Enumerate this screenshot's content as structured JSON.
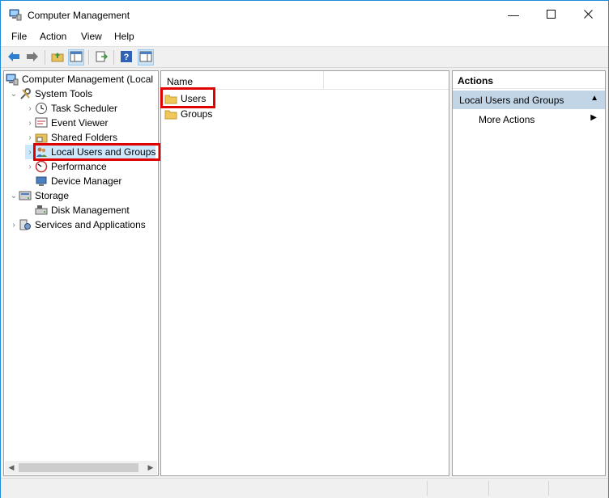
{
  "window": {
    "title": "Computer Management",
    "controls": [
      "minimize",
      "maximize",
      "close"
    ]
  },
  "menu": [
    "File",
    "Action",
    "View",
    "Help"
  ],
  "toolbar": {
    "buttons": [
      "back-icon",
      "forward-icon",
      "up-folder-icon",
      "show-hide-console-tree-icon",
      "export-list-icon",
      "help-icon",
      "show-hide-action-pane-icon"
    ]
  },
  "tree": {
    "root": "Computer Management (Local",
    "items": [
      {
        "label": "System Tools",
        "level": 1,
        "expanded": true
      },
      {
        "label": "Task Scheduler",
        "level": 2
      },
      {
        "label": "Event Viewer",
        "level": 2
      },
      {
        "label": "Shared Folders",
        "level": 2
      },
      {
        "label": "Local Users and Groups",
        "level": 2,
        "selected": true
      },
      {
        "label": "Performance",
        "level": 2
      },
      {
        "label": "Device Manager",
        "level": 2
      },
      {
        "label": "Storage",
        "level": 1,
        "expanded": true
      },
      {
        "label": "Disk Management",
        "level": 2
      },
      {
        "label": "Services and Applications",
        "level": 1
      }
    ]
  },
  "list": {
    "column": "Name",
    "items": [
      "Users",
      "Groups"
    ]
  },
  "actions": {
    "header": "Actions",
    "section": "Local Users and Groups",
    "items": [
      "More Actions"
    ]
  },
  "colors": {
    "highlight": "#e00000",
    "selection": "#cce8ff",
    "section": "#c2d5e6",
    "border": "#1e8bd6"
  }
}
